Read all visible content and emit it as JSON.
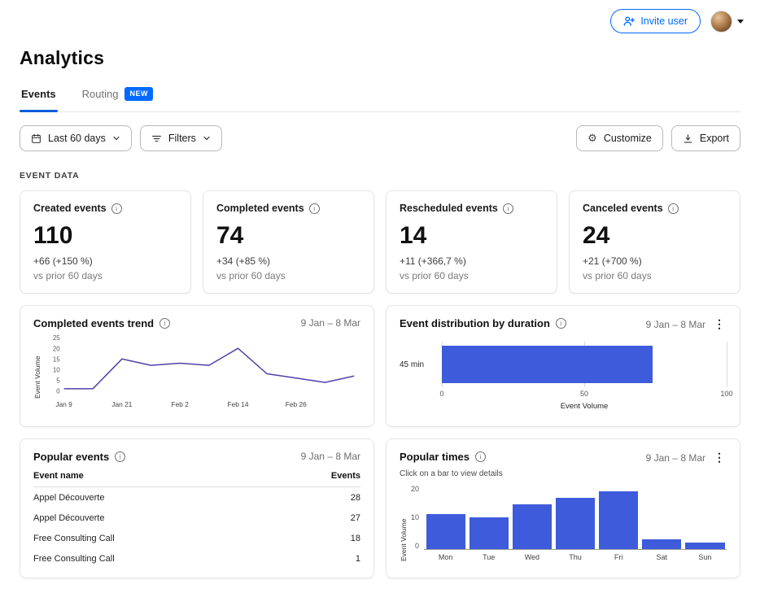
{
  "colors": {
    "accent": "#0069ff",
    "bar_fill": "#3d5bdb",
    "line_stroke": "#5240a8"
  },
  "topbar": {
    "invite_user_label": "Invite user"
  },
  "page": {
    "title": "Analytics",
    "section_label": "EVENT DATA"
  },
  "tabs": [
    {
      "label": "Events"
    },
    {
      "label": "Routing",
      "badge": "NEW"
    }
  ],
  "toolbar": {
    "date_range_label": "Last 60 days",
    "filters_label": "Filters",
    "customize_label": "Customize",
    "export_label": "Export"
  },
  "stats": [
    {
      "title": "Created events",
      "value": "110",
      "delta": "+66 (+150 %)",
      "caption": "vs prior 60 days"
    },
    {
      "title": "Completed events",
      "value": "74",
      "delta": "+34 (+85 %)",
      "caption": "vs prior 60 days"
    },
    {
      "title": "Rescheduled events",
      "value": "14",
      "delta": "+11 (+366,7 %)",
      "caption": "vs prior 60 days"
    },
    {
      "title": "Canceled events",
      "value": "24",
      "delta": "+21 (+700 %)",
      "caption": "vs prior 60 days"
    }
  ],
  "trend_card": {
    "title": "Completed events trend",
    "date_range": "9 Jan – 8 Mar"
  },
  "duration_card": {
    "title": "Event distribution by duration",
    "date_range": "9 Jan – 8 Mar"
  },
  "popular_events_card": {
    "title": "Popular events",
    "date_range": "9 Jan – 8 Mar",
    "columns": [
      "Event name",
      "Events"
    ],
    "rows": [
      {
        "name": "Appel Découverte",
        "count": "28"
      },
      {
        "name": "Appel Découverte",
        "count": "27"
      },
      {
        "name": "Free Consulting Call",
        "count": "18"
      },
      {
        "name": "Free Consulting Call",
        "count": "1"
      }
    ]
  },
  "popular_times_card": {
    "title": "Popular times",
    "date_range": "9 Jan – 8 Mar",
    "hint": "Click on a bar to view details"
  },
  "chart_data": [
    {
      "id": "completed_events_trend",
      "type": "line",
      "title": "Completed events trend",
      "ylabel": "Event Volume",
      "ylim": [
        0,
        25
      ],
      "yticks": [
        0,
        5,
        10,
        15,
        20,
        25
      ],
      "xticks": [
        "Jan 9",
        "Jan 21",
        "Feb 2",
        "Feb 14",
        "Feb 26"
      ],
      "x": [
        "Jan 9",
        "Jan 15",
        "Jan 21",
        "Jan 27",
        "Feb 2",
        "Feb 8",
        "Feb 14",
        "Feb 20",
        "Feb 26",
        "Mar 3",
        "Mar 8"
      ],
      "values": [
        1,
        1,
        15,
        12,
        13,
        12,
        20,
        8,
        6,
        4,
        7
      ],
      "grid": false
    },
    {
      "id": "event_distribution_by_duration",
      "type": "bar-horizontal",
      "title": "Event distribution by duration",
      "xlabel": "Event Volume",
      "xlim": [
        0,
        100
      ],
      "xticks": [
        0,
        50,
        100
      ],
      "categories": [
        "45 min"
      ],
      "values": [
        74
      ]
    },
    {
      "id": "popular_times",
      "type": "bar",
      "title": "Popular times",
      "ylabel": "Event Volume",
      "ylim": [
        0,
        20
      ],
      "yticks": [
        0,
        10,
        20
      ],
      "categories": [
        "Mon",
        "Tue",
        "Wed",
        "Thu",
        "Fri",
        "Sat",
        "Sun"
      ],
      "values": [
        11,
        10,
        14,
        16,
        18,
        3,
        2
      ]
    }
  ]
}
